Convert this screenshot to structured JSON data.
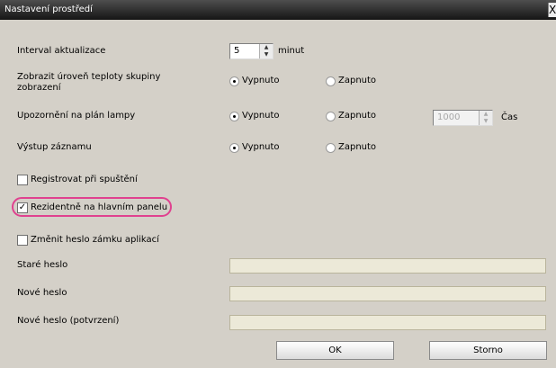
{
  "window": {
    "title": "Nastavení prostředí",
    "close_label": "X"
  },
  "settings": {
    "interval": {
      "label": "Interval aktualizace",
      "value": "5",
      "unit": "minut"
    },
    "group_temp": {
      "label": "Zobrazit úroveň teploty skupiny zobrazení",
      "options": [
        "Vypnuto",
        "Zapnuto"
      ],
      "selected": "Vypnuto"
    },
    "lamp_plan": {
      "label": "Upozornění na plán lampy",
      "options": [
        "Vypnuto",
        "Zapnuto"
      ],
      "selected": "Vypnuto",
      "hours_value": "1000",
      "hours_unit": "Čas"
    },
    "log_output": {
      "label": "Výstup záznamu",
      "options": [
        "Vypnuto",
        "Zapnuto"
      ],
      "selected": "Vypnuto"
    },
    "register_startup": {
      "label": "Registrovat při spuštění",
      "checked": false
    },
    "resident_taskbar": {
      "label": "Rezidentně na hlavním panelu",
      "checked": true
    },
    "change_lock_password": {
      "label": "Změnit heslo zámku aplikací",
      "checked": false
    },
    "old_password": {
      "label": "Staré heslo",
      "value": ""
    },
    "new_password": {
      "label": "Nové heslo",
      "value": ""
    },
    "confirm_password": {
      "label": "Nové heslo (potvrzení)",
      "value": ""
    }
  },
  "buttons": {
    "ok": "OK",
    "cancel": "Storno"
  },
  "colors": {
    "dialog_bg": "#d4d0c8",
    "highlight": "#e0418f",
    "disabled_field": "#ece9d8"
  }
}
